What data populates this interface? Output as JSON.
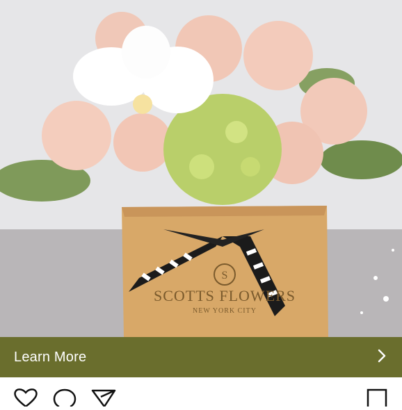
{
  "media": {
    "brand_name": "SCOTTS FLOWERS",
    "brand_city": "NEW YORK CITY",
    "brand_monogram": "S"
  },
  "cta": {
    "label": "Learn More",
    "chevron_icon": "chevron-right-icon",
    "background": "#6a6e2d"
  },
  "actions": {
    "icons": [
      "heart-icon",
      "comment-icon",
      "share-icon",
      "bookmark-icon"
    ]
  }
}
